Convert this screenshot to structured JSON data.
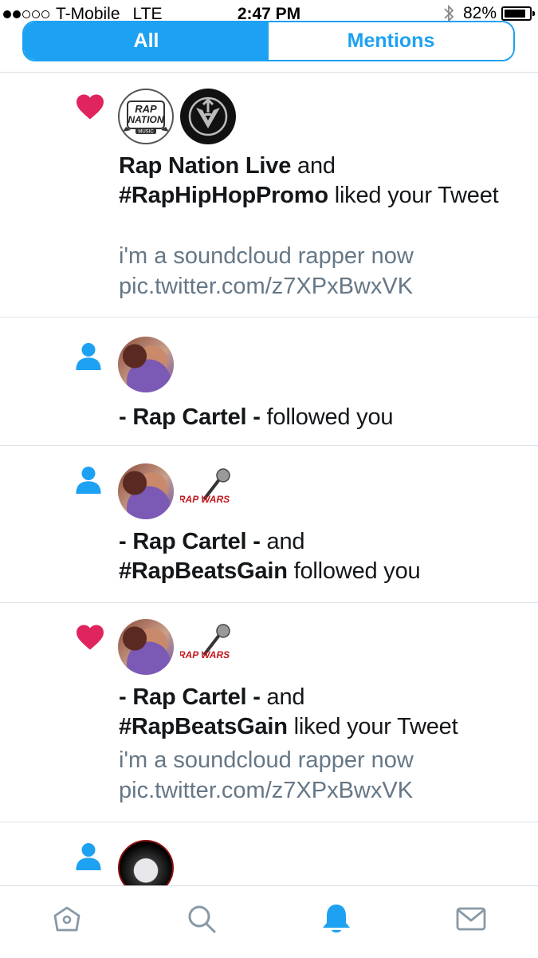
{
  "status_bar": {
    "carrier": "T-Mobile",
    "network": "LTE",
    "time": "2:47 PM",
    "battery": "82%",
    "battery_level": 0.82,
    "signal_bars_filled": 2,
    "signal_bars_total": 5
  },
  "segmented_control": {
    "all_label": "All",
    "mentions_label": "Mentions",
    "selected": "All"
  },
  "colors": {
    "accent": "#1da1f2",
    "like": "#e0245e",
    "muted_text": "#657786"
  },
  "notifications": [
    {
      "type": "like",
      "icon": "heart-icon",
      "avatars": [
        "rap-nation-avatar",
        "vegeta-emblem-avatar"
      ],
      "rap_nation_logo": {
        "line1": "RAP",
        "line2": "NATION",
        "line3": "MUSIC"
      },
      "actor1": "Rap Nation Live",
      "connector": " and ",
      "actor2": "#RapHipHopPromo",
      "action": " liked your Tweet",
      "tweet_line1": "i'm a soundcloud rapper now",
      "tweet_line2": "pic.twitter.com/z7XPxBwxVK"
    },
    {
      "type": "follow",
      "icon": "person-icon",
      "avatars": [
        "rap-cartel-avatar"
      ],
      "actor1": "- Rap Cartel -",
      "action": " followed you"
    },
    {
      "type": "follow",
      "icon": "person-icon",
      "avatars": [
        "rap-cartel-avatar",
        "rap-wars-avatar"
      ],
      "rap_wars_logo": "RAP WARS",
      "actor1": "- Rap Cartel -",
      "connector": " and",
      "actor2": "#RapBeatsGain",
      "action": " followed you"
    },
    {
      "type": "like",
      "icon": "heart-icon",
      "avatars": [
        "rap-cartel-avatar",
        "rap-wars-avatar"
      ],
      "rap_wars_logo": "RAP WARS",
      "actor1": "- Rap Cartel -",
      "connector": " and",
      "actor2": "#RapBeatsGain",
      "action": " liked your Tweet",
      "tweet_line1": "i'm a soundcloud rapper now",
      "tweet_line2": "pic.twitter.com/z7XPxBwxVK"
    },
    {
      "type": "follow",
      "icon": "person-icon",
      "avatars": [
        "ghost-avatar"
      ]
    }
  ],
  "tab_bar": {
    "items": [
      "home-icon",
      "search-icon",
      "notifications-bell-icon",
      "messages-envelope-icon"
    ],
    "active": "notifications-bell-icon"
  }
}
